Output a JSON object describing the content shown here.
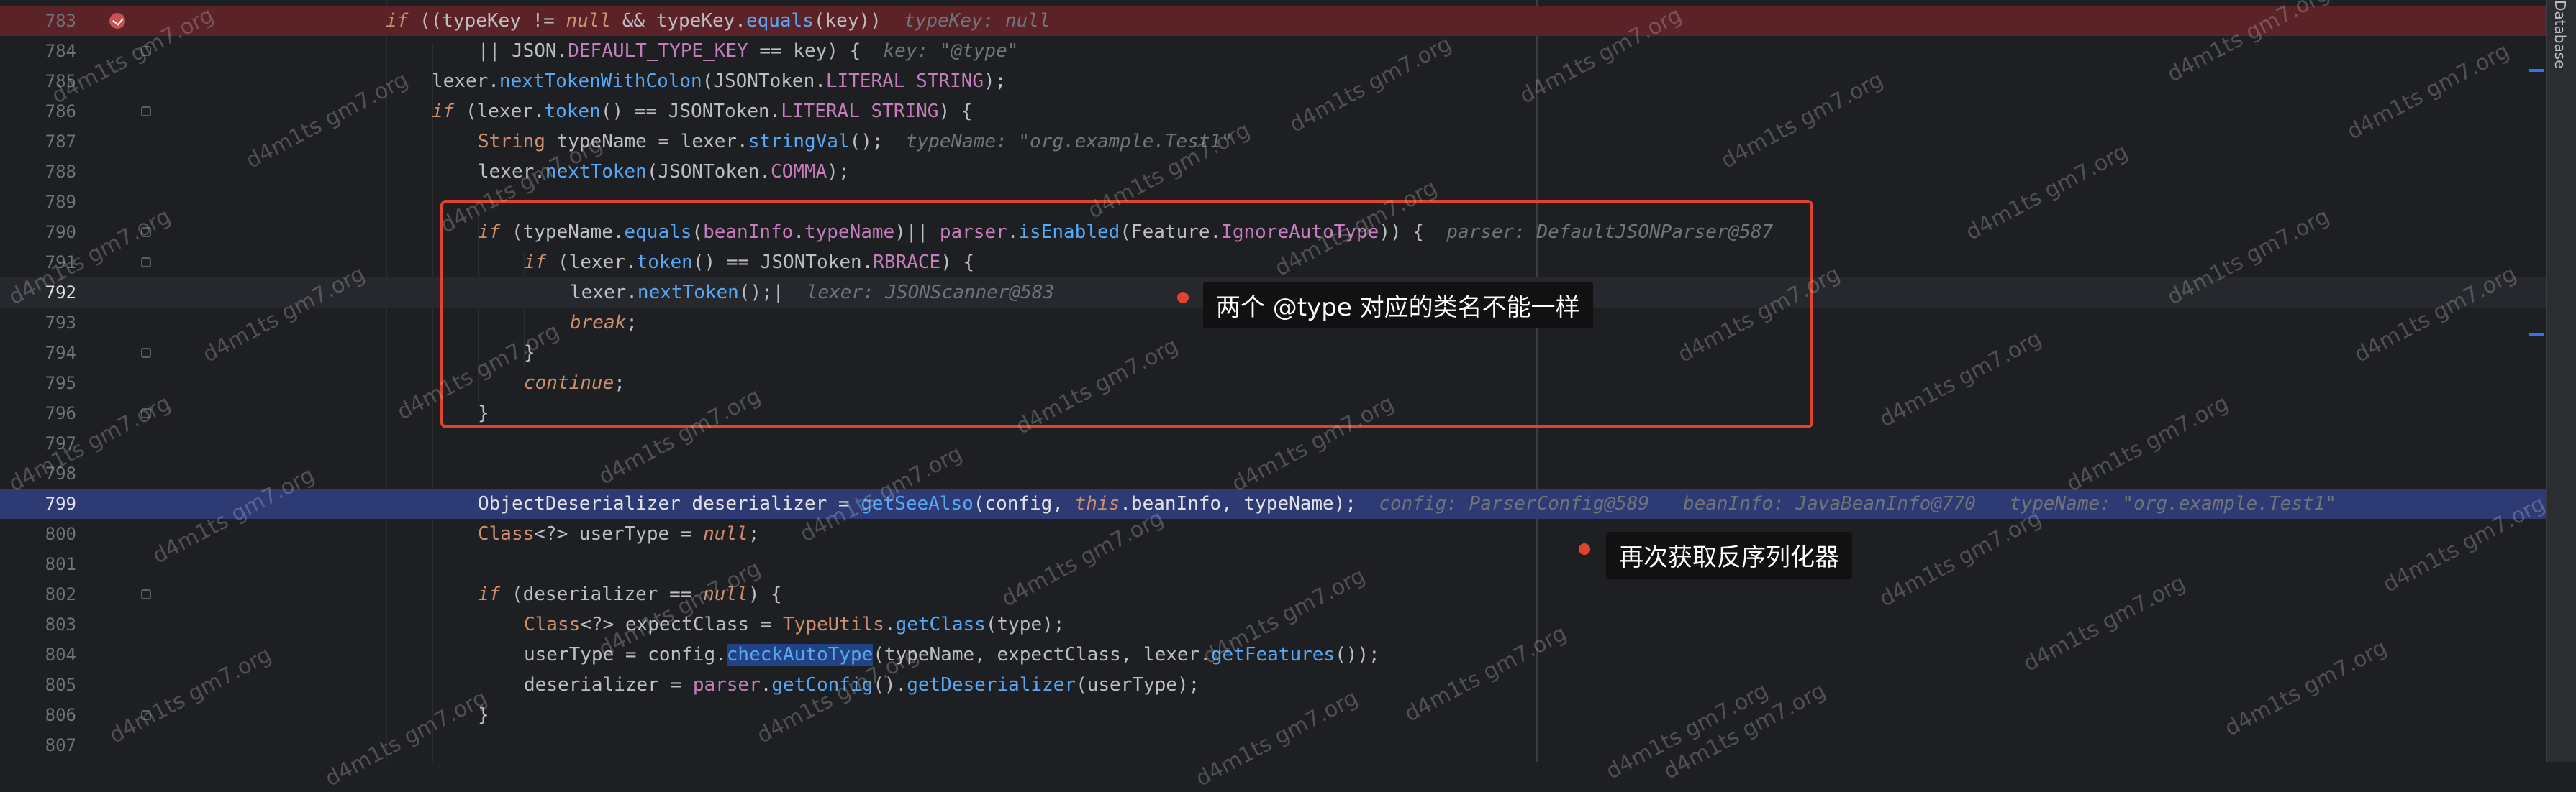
{
  "panel": {
    "side_label": "Database"
  },
  "annotations": {
    "a1": "两个 @type 对应的类名不能一样",
    "a2": "再次获取反序列化器"
  },
  "watermark_text": "d4m1ts gm7.org",
  "lines": {
    "l783": "783",
    "l784": "784",
    "l785": "785",
    "l786": "786",
    "l787": "787",
    "l788": "788",
    "l789": "789",
    "l790": "790",
    "l791": "791",
    "l792": "792",
    "l793": "793",
    "l794": "794",
    "l795": "795",
    "l796": "796",
    "l797": "797",
    "l798": "798",
    "l799": "799",
    "l800": "800",
    "l801": "801",
    "l802": "802",
    "l803": "803",
    "l804": "804",
    "l805": "805",
    "l806": "806",
    "l807": "807"
  },
  "hints": {
    "h783": "typeKey: null",
    "h784": "key: \"@type\"",
    "h787": "typeName: \"org.example.Test1\"",
    "h790": "parser: DefaultJSONParser@587",
    "h792": "lexer: JSONScanner@583",
    "h799": "config: ParserConfig@589   beanInfo: JavaBeanInfo@770   typeName: \"org.example.Test1\""
  }
}
